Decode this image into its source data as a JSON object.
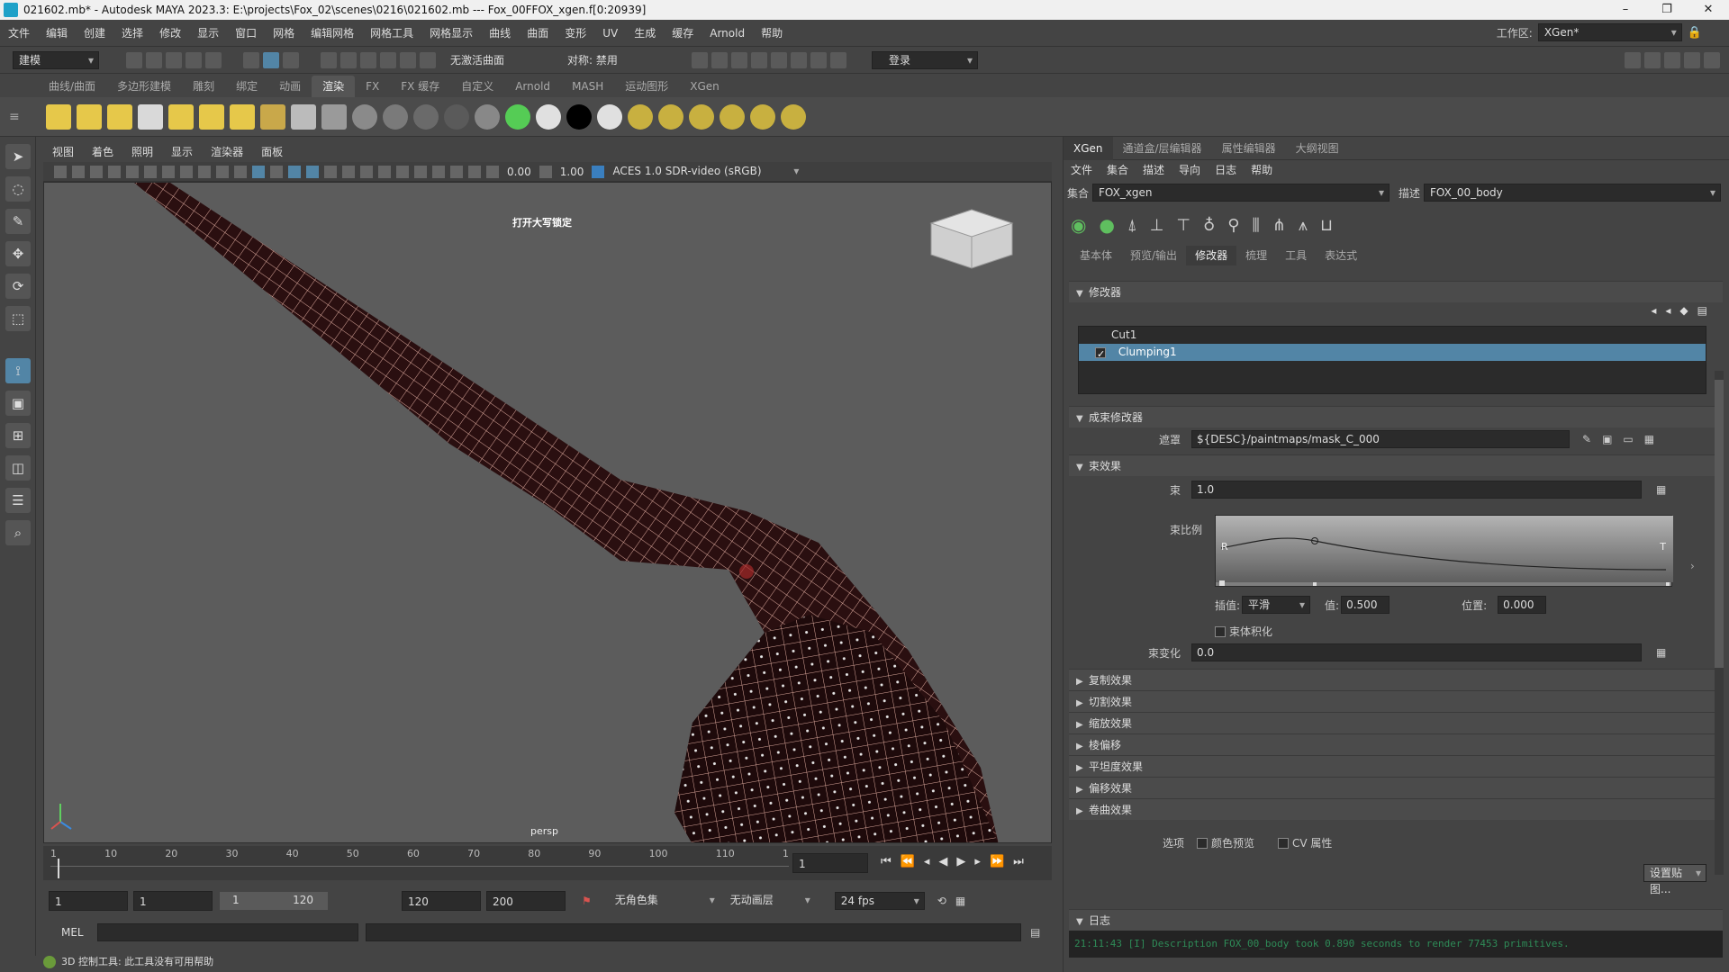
{
  "titlebar": {
    "title": "021602.mb* - Autodesk MAYA 2023.3: E:\\projects\\Fox_02\\scenes\\0216\\021602.mb   ---   Fox_00FFOX_xgen.f[0:20939]",
    "minimize": "–",
    "restore": "❐",
    "close": "✕"
  },
  "menubar": {
    "items": [
      "文件",
      "编辑",
      "创建",
      "选择",
      "修改",
      "显示",
      "窗口",
      "网格",
      "编辑网格",
      "网格工具",
      "网格显示",
      "曲线",
      "曲面",
      "变形",
      "UV",
      "生成",
      "缓存",
      "Arnold",
      "帮助"
    ],
    "workspace_label": "工作区:",
    "workspace_value": "XGen*"
  },
  "statusline": {
    "mode": "建模",
    "live_surface": "无激活曲面",
    "symmetry": "对称: 禁用",
    "login": "登录"
  },
  "shelf": {
    "tabs": [
      "曲线/曲面",
      "多边形建模",
      "雕刻",
      "绑定",
      "动画",
      "渲染",
      "FX",
      "FX 缓存",
      "自定义",
      "Arnold",
      "MASH",
      "运动图形",
      "XGen"
    ],
    "active_tab": "渲染",
    "icon_colors": [
      "#e6c84a",
      "#e6c84a",
      "#e6c84a",
      "#d9d9d9",
      "#e6c84a",
      "#e6c84a",
      "#e6c84a",
      "#c9a84a",
      "#bbbbbb",
      "#9a9a9a",
      "#8a8a8a",
      "#7a7a7a",
      "#6a6a6a",
      "#5a5a5a",
      "#888888",
      "#55cc55",
      "#e0e0e0",
      "#000000",
      "#e0e0e0",
      "#c8b040",
      "#c8b040",
      "#c8b040",
      "#c8b040",
      "#c8b040",
      "#c8b040"
    ]
  },
  "viewport": {
    "menu": [
      "视图",
      "着色",
      "照明",
      "显示",
      "渲染器",
      "面板"
    ],
    "exposure": "0.00",
    "gamma": "1.00",
    "colorspace": "ACES 1.0 SDR-video (sRGB)",
    "hud_title": "打开大写锁定",
    "camera": "persp"
  },
  "timeslider": {
    "ticks": [
      "1",
      "10",
      "20",
      "30",
      "40",
      "50",
      "60",
      "70",
      "80",
      "90",
      "100",
      "110",
      "1"
    ],
    "current_frame": "1"
  },
  "rangeslider": {
    "start": "1",
    "playback_start": "1",
    "range_low": "1",
    "range_high": "120",
    "playback_end": "120",
    "end": "200",
    "character_set": "无角色集",
    "anim_layer": "无动画层",
    "fps": "24 fps"
  },
  "cmdline": {
    "label": "MEL"
  },
  "helpline": {
    "text": "3D 控制工具: 此工具没有可用帮助"
  },
  "xgen": {
    "panel_tabs": [
      "XGen",
      "通道盒/层编辑器",
      "属性编辑器",
      "大纲视图"
    ],
    "menu": [
      "文件",
      "集合",
      "描述",
      "导向",
      "日志",
      "帮助"
    ],
    "collection_label": "集合",
    "collection_value": "FOX_xgen",
    "description_label": "描述",
    "description_value": "FOX_00_body",
    "subtabs": [
      "基本体",
      "预览/输出",
      "修改器",
      "梳理",
      "工具",
      "表达式"
    ],
    "active_subtab": "修改器",
    "modifiers_section": "修改器",
    "modifiers": [
      {
        "name": "Cut1",
        "checked": false,
        "selected": false
      },
      {
        "name": "Clumping1",
        "checked": true,
        "selected": true
      }
    ],
    "clump_section": "成束修改器",
    "mask_label": "遮罩",
    "mask_value": "${DESC}/paintmaps/mask_C_000",
    "clump_effect_section": "束效果",
    "clump_label": "束",
    "clump_value": "1.0",
    "clump_scale_label": "束比例",
    "interp_label": "插值:",
    "interp_value": "平滑",
    "value_label": "值:",
    "value_value": "0.500",
    "position_label": "位置:",
    "position_value": "0.000",
    "clump_volume_label": "束体积化",
    "clump_variation_label": "束变化",
    "clump_variation_value": "0.0",
    "ramp_left_label": "R",
    "ramp_right_label": "T",
    "collapsed_sections": [
      "复制效果",
      "切割效果",
      "缩放效果",
      "棱偏移",
      "平坦度效果",
      "偏移效果",
      "卷曲效果"
    ],
    "options_label": "选项",
    "color_preview_label": "颜色预览",
    "cv_attr_label": "CV 属性",
    "setup_maps_button": "设置贴图...",
    "log_section": "日志",
    "log_text": "21:11:43 [I] Description FOX_00_body took 0.890 seconds to render 77453 primitives."
  }
}
